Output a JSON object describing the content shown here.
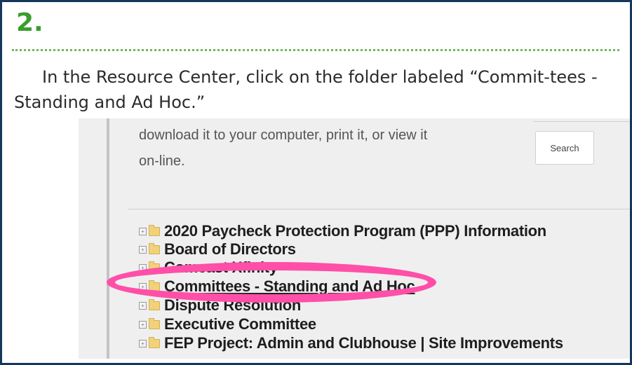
{
  "step": {
    "number": "2."
  },
  "instruction": "In the Resource Center, click on the folder labeled “Commit-tees - Standing and Ad Hoc.”",
  "screenshot": {
    "description_line1": "download it to your computer, print it, or view it",
    "description_line2": "on-line.",
    "search_label": "Search",
    "folders": [
      {
        "label": "2020 Paycheck Protection Program (PPP) Information"
      },
      {
        "label": "Board of Directors"
      },
      {
        "label": "Comcast Xfinity"
      },
      {
        "label": "Committees - Standing and Ad Hoc"
      },
      {
        "label": "Dispute Resolution"
      },
      {
        "label": "Executive Committee"
      },
      {
        "label": "FEP Project: Admin and Clubhouse | Site Improvements"
      }
    ]
  },
  "colors": {
    "step_number": "#3a9d2d",
    "border": "#14385c",
    "highlight": "#ff4fa8"
  }
}
